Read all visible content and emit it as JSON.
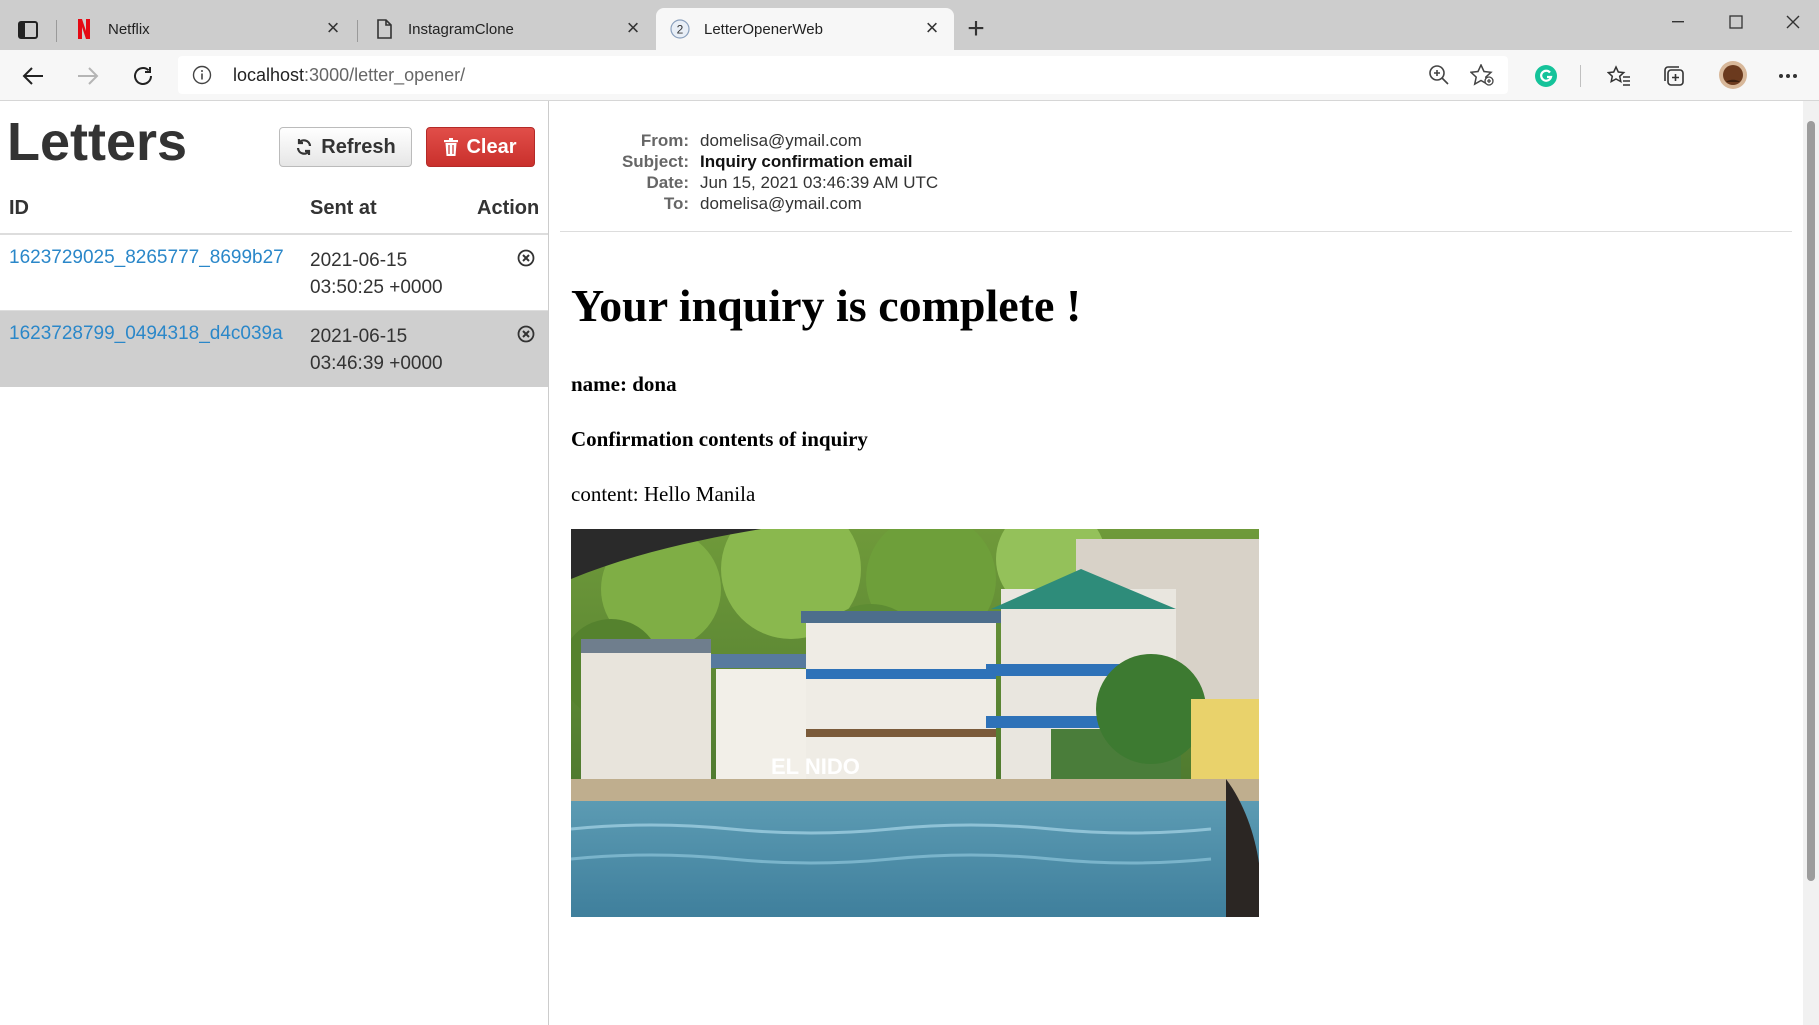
{
  "browser": {
    "tabs": [
      {
        "title": "Netflix",
        "icon": "netflix-icon"
      },
      {
        "title": "InstagramClone",
        "icon": "page-icon"
      },
      {
        "title": "LetterOpenerWeb",
        "icon": "tab-count-icon",
        "badge": "2",
        "active": true
      }
    ],
    "url": {
      "host": "localhost",
      "path": ":3000/letter_opener/"
    },
    "accent": "#2a87c9"
  },
  "letters": {
    "title": "Letters",
    "refresh_label": "Refresh",
    "clear_label": "Clear",
    "columns": {
      "id": "ID",
      "sent_at": "Sent at",
      "action": "Action"
    },
    "rows": [
      {
        "id": "1623729025_8265777_8699b27",
        "date": "2021-06-15",
        "time": "03:50:25 +0000",
        "selected": false
      },
      {
        "id": "1623728799_0494318_d4c039a",
        "date": "2021-06-15",
        "time": "03:46:39 +0000",
        "selected": true
      }
    ]
  },
  "email": {
    "from_label": "From:",
    "from": "domelisa@ymail.com",
    "subject_label": "Subject:",
    "subject": "Inquiry confirmation email",
    "date_label": "Date:",
    "date": "Jun 15, 2021 03:46:39 AM UTC",
    "to_label": "To:",
    "to": "domelisa@ymail.com",
    "heading": "Your inquiry is complete !",
    "name_line": "name: dona",
    "section_heading": "Confirmation contents of inquiry",
    "content_line": "content: Hello Manila",
    "image_sign_text": "EL NIDO"
  }
}
